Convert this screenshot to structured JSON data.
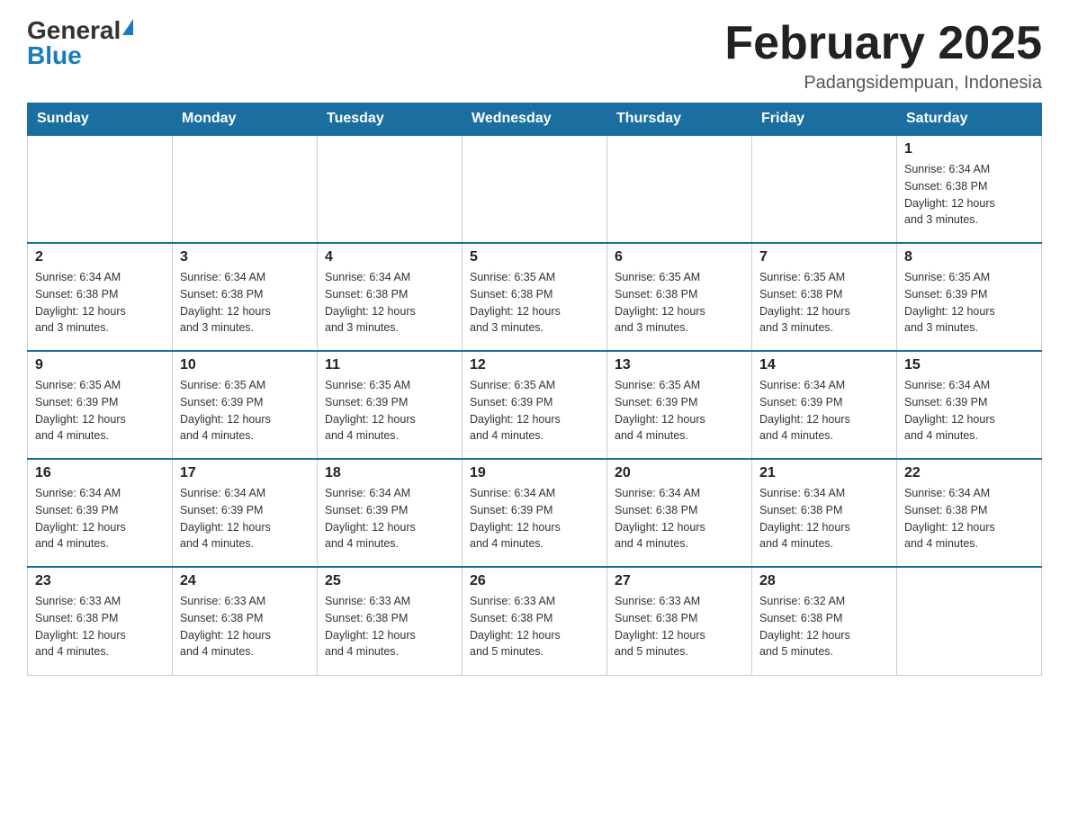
{
  "logo": {
    "general": "General",
    "blue": "Blue"
  },
  "title": "February 2025",
  "location": "Padangsidempuan, Indonesia",
  "weekdays": [
    "Sunday",
    "Monday",
    "Tuesday",
    "Wednesday",
    "Thursday",
    "Friday",
    "Saturday"
  ],
  "weeks": [
    [
      {
        "day": "",
        "info": ""
      },
      {
        "day": "",
        "info": ""
      },
      {
        "day": "",
        "info": ""
      },
      {
        "day": "",
        "info": ""
      },
      {
        "day": "",
        "info": ""
      },
      {
        "day": "",
        "info": ""
      },
      {
        "day": "1",
        "info": "Sunrise: 6:34 AM\nSunset: 6:38 PM\nDaylight: 12 hours\nand 3 minutes."
      }
    ],
    [
      {
        "day": "2",
        "info": "Sunrise: 6:34 AM\nSunset: 6:38 PM\nDaylight: 12 hours\nand 3 minutes."
      },
      {
        "day": "3",
        "info": "Sunrise: 6:34 AM\nSunset: 6:38 PM\nDaylight: 12 hours\nand 3 minutes."
      },
      {
        "day": "4",
        "info": "Sunrise: 6:34 AM\nSunset: 6:38 PM\nDaylight: 12 hours\nand 3 minutes."
      },
      {
        "day": "5",
        "info": "Sunrise: 6:35 AM\nSunset: 6:38 PM\nDaylight: 12 hours\nand 3 minutes."
      },
      {
        "day": "6",
        "info": "Sunrise: 6:35 AM\nSunset: 6:38 PM\nDaylight: 12 hours\nand 3 minutes."
      },
      {
        "day": "7",
        "info": "Sunrise: 6:35 AM\nSunset: 6:38 PM\nDaylight: 12 hours\nand 3 minutes."
      },
      {
        "day": "8",
        "info": "Sunrise: 6:35 AM\nSunset: 6:39 PM\nDaylight: 12 hours\nand 3 minutes."
      }
    ],
    [
      {
        "day": "9",
        "info": "Sunrise: 6:35 AM\nSunset: 6:39 PM\nDaylight: 12 hours\nand 4 minutes."
      },
      {
        "day": "10",
        "info": "Sunrise: 6:35 AM\nSunset: 6:39 PM\nDaylight: 12 hours\nand 4 minutes."
      },
      {
        "day": "11",
        "info": "Sunrise: 6:35 AM\nSunset: 6:39 PM\nDaylight: 12 hours\nand 4 minutes."
      },
      {
        "day": "12",
        "info": "Sunrise: 6:35 AM\nSunset: 6:39 PM\nDaylight: 12 hours\nand 4 minutes."
      },
      {
        "day": "13",
        "info": "Sunrise: 6:35 AM\nSunset: 6:39 PM\nDaylight: 12 hours\nand 4 minutes."
      },
      {
        "day": "14",
        "info": "Sunrise: 6:34 AM\nSunset: 6:39 PM\nDaylight: 12 hours\nand 4 minutes."
      },
      {
        "day": "15",
        "info": "Sunrise: 6:34 AM\nSunset: 6:39 PM\nDaylight: 12 hours\nand 4 minutes."
      }
    ],
    [
      {
        "day": "16",
        "info": "Sunrise: 6:34 AM\nSunset: 6:39 PM\nDaylight: 12 hours\nand 4 minutes."
      },
      {
        "day": "17",
        "info": "Sunrise: 6:34 AM\nSunset: 6:39 PM\nDaylight: 12 hours\nand 4 minutes."
      },
      {
        "day": "18",
        "info": "Sunrise: 6:34 AM\nSunset: 6:39 PM\nDaylight: 12 hours\nand 4 minutes."
      },
      {
        "day": "19",
        "info": "Sunrise: 6:34 AM\nSunset: 6:39 PM\nDaylight: 12 hours\nand 4 minutes."
      },
      {
        "day": "20",
        "info": "Sunrise: 6:34 AM\nSunset: 6:38 PM\nDaylight: 12 hours\nand 4 minutes."
      },
      {
        "day": "21",
        "info": "Sunrise: 6:34 AM\nSunset: 6:38 PM\nDaylight: 12 hours\nand 4 minutes."
      },
      {
        "day": "22",
        "info": "Sunrise: 6:34 AM\nSunset: 6:38 PM\nDaylight: 12 hours\nand 4 minutes."
      }
    ],
    [
      {
        "day": "23",
        "info": "Sunrise: 6:33 AM\nSunset: 6:38 PM\nDaylight: 12 hours\nand 4 minutes."
      },
      {
        "day": "24",
        "info": "Sunrise: 6:33 AM\nSunset: 6:38 PM\nDaylight: 12 hours\nand 4 minutes."
      },
      {
        "day": "25",
        "info": "Sunrise: 6:33 AM\nSunset: 6:38 PM\nDaylight: 12 hours\nand 4 minutes."
      },
      {
        "day": "26",
        "info": "Sunrise: 6:33 AM\nSunset: 6:38 PM\nDaylight: 12 hours\nand 5 minutes."
      },
      {
        "day": "27",
        "info": "Sunrise: 6:33 AM\nSunset: 6:38 PM\nDaylight: 12 hours\nand 5 minutes."
      },
      {
        "day": "28",
        "info": "Sunrise: 6:32 AM\nSunset: 6:38 PM\nDaylight: 12 hours\nand 5 minutes."
      },
      {
        "day": "",
        "info": ""
      }
    ]
  ]
}
